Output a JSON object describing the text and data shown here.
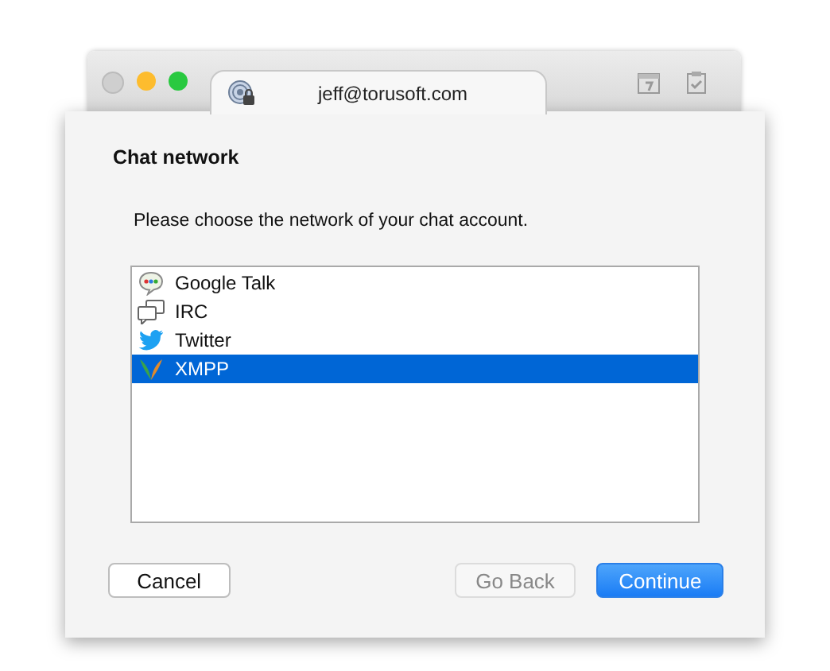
{
  "window": {
    "tab_title": "jeff@torusoft.com"
  },
  "sheet": {
    "title": "Chat network",
    "instruction": "Please choose the network of your chat account.",
    "networks": [
      {
        "label": "Google Talk",
        "kind": "gtalk",
        "selected": false
      },
      {
        "label": "IRC",
        "kind": "irc",
        "selected": false
      },
      {
        "label": "Twitter",
        "kind": "twitter",
        "selected": false
      },
      {
        "label": "XMPP",
        "kind": "xmpp",
        "selected": true
      }
    ],
    "buttons": [
      {
        "label": "Cancel",
        "kind": "plain",
        "disabled": false
      },
      {
        "label": "Go Back",
        "kind": "plain",
        "disabled": true
      },
      {
        "label": "Continue",
        "kind": "default",
        "disabled": false
      }
    ]
  }
}
